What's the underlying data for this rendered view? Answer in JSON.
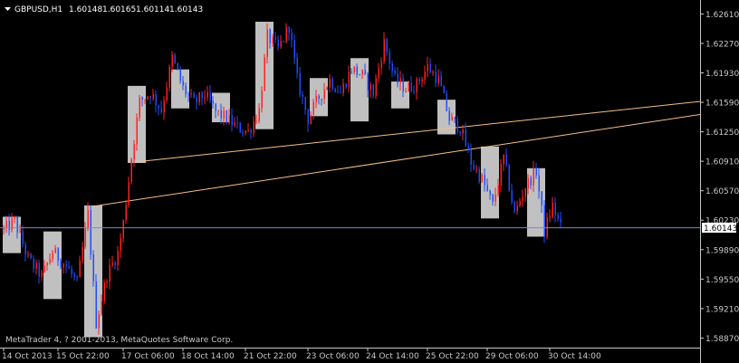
{
  "header": {
    "symbol_timeframe": "GBPUSD,H1",
    "open": "1.60148",
    "high": "1.60165",
    "low": "1.60114",
    "close": "1.60143"
  },
  "footer": {
    "copyright": "MetaTrader 4, ? 2001-2013, MetaQuotes Software Corp."
  },
  "current_price": {
    "label": "1.60143",
    "value": 1.60143
  },
  "colors": {
    "background": "#000000",
    "up_candle": "#ff2020",
    "down_candle": "#1e4dff",
    "box_fill": "#c0c0c0",
    "trendline": "#f5c08a",
    "price_line": "#6f8fbf",
    "axis": "#c8c8c8"
  },
  "chart_data": {
    "type": "candlestick",
    "title": "GBPUSD,H1",
    "ylim": [
      1.5877,
      1.6275
    ],
    "y_ticks": [
      {
        "label": "1.62610",
        "value": 1.6261
      },
      {
        "label": "1.62270",
        "value": 1.6227
      },
      {
        "label": "1.61930",
        "value": 1.6193
      },
      {
        "label": "1.61590",
        "value": 1.6159
      },
      {
        "label": "1.61250",
        "value": 1.6125
      },
      {
        "label": "1.60910",
        "value": 1.6091
      },
      {
        "label": "1.60570",
        "value": 1.6057
      },
      {
        "label": "1.60230",
        "value": 1.6023
      },
      {
        "label": "1.59890",
        "value": 1.5989
      },
      {
        "label": "1.59550",
        "value": 1.5955
      },
      {
        "label": "1.59210",
        "value": 1.5921
      },
      {
        "label": "1.58870",
        "value": 1.5887
      }
    ],
    "x_ticks": [
      {
        "label": "14 Oct 2013",
        "bar": 0
      },
      {
        "label": "15 Oct 22:00",
        "bar": 20
      },
      {
        "label": "17 Oct 06:00",
        "bar": 44
      },
      {
        "label": "18 Oct 14:00",
        "bar": 66
      },
      {
        "label": "21 Oct 22:00",
        "bar": 89
      },
      {
        "label": "23 Oct 06:00",
        "bar": 112
      },
      {
        "label": "24 Oct 14:00",
        "bar": 134
      },
      {
        "label": "25 Oct 22:00",
        "bar": 156
      },
      {
        "label": "29 Oct 06:00",
        "bar": 178
      },
      {
        "label": "30 Oct 14:00",
        "bar": 201
      }
    ],
    "bar_count": 205,
    "anchors": [
      [
        0,
        1.6012
      ],
      [
        4,
        1.6022
      ],
      [
        9,
        1.5978
      ],
      [
        14,
        1.5958
      ],
      [
        18,
        1.5987
      ],
      [
        23,
        1.597
      ],
      [
        27,
        1.595
      ],
      [
        31,
        1.603
      ],
      [
        34,
        1.5905
      ],
      [
        38,
        1.596
      ],
      [
        42,
        1.5985
      ],
      [
        44,
        1.602
      ],
      [
        47,
        1.6095
      ],
      [
        50,
        1.616
      ],
      [
        54,
        1.617
      ],
      [
        58,
        1.615
      ],
      [
        62,
        1.621
      ],
      [
        66,
        1.6175
      ],
      [
        70,
        1.6158
      ],
      [
        74,
        1.6168
      ],
      [
        78,
        1.6148
      ],
      [
        82,
        1.614
      ],
      [
        86,
        1.613
      ],
      [
        90,
        1.6125
      ],
      [
        94,
        1.615
      ],
      [
        97,
        1.6235
      ],
      [
        101,
        1.622
      ],
      [
        105,
        1.6247
      ],
      [
        108,
        1.6185
      ],
      [
        112,
        1.614
      ],
      [
        116,
        1.6165
      ],
      [
        120,
        1.6185
      ],
      [
        124,
        1.617
      ],
      [
        128,
        1.6198
      ],
      [
        132,
        1.619
      ],
      [
        136,
        1.617
      ],
      [
        140,
        1.6228
      ],
      [
        144,
        1.6185
      ],
      [
        148,
        1.6175
      ],
      [
        152,
        1.618
      ],
      [
        156,
        1.62
      ],
      [
        160,
        1.6185
      ],
      [
        164,
        1.614
      ],
      [
        168,
        1.613
      ],
      [
        172,
        1.609
      ],
      [
        176,
        1.607
      ],
      [
        180,
        1.604
      ],
      [
        184,
        1.6095
      ],
      [
        188,
        1.603
      ],
      [
        192,
        1.6062
      ],
      [
        196,
        1.608
      ],
      [
        199,
        1.601
      ],
      [
        202,
        1.604
      ],
      [
        205,
        1.6014
      ]
    ],
    "boxes": [
      {
        "bar_start": 0,
        "bar_end": 6,
        "high": 1.6027,
        "low": 1.5985
      },
      {
        "bar_start": 15,
        "bar_end": 21,
        "high": 1.601,
        "low": 1.5932
      },
      {
        "bar_start": 30,
        "bar_end": 36,
        "high": 1.604,
        "low": 1.5888
      },
      {
        "bar_start": 46,
        "bar_end": 52,
        "high": 1.6178,
        "low": 1.6089
      },
      {
        "bar_start": 62,
        "bar_end": 68,
        "high": 1.6197,
        "low": 1.6152
      },
      {
        "bar_start": 77,
        "bar_end": 83,
        "high": 1.617,
        "low": 1.6136
      },
      {
        "bar_start": 93,
        "bar_end": 99,
        "high": 1.6252,
        "low": 1.6128
      },
      {
        "bar_start": 113,
        "bar_end": 119,
        "high": 1.6187,
        "low": 1.6143
      },
      {
        "bar_start": 128,
        "bar_end": 134,
        "high": 1.621,
        "low": 1.6137
      },
      {
        "bar_start": 143,
        "bar_end": 149,
        "high": 1.6183,
        "low": 1.6152
      },
      {
        "bar_start": 160,
        "bar_end": 166,
        "high": 1.6162,
        "low": 1.6122
      },
      {
        "bar_start": 176,
        "bar_end": 182,
        "high": 1.6108,
        "low": 1.6025
      },
      {
        "bar_start": 193,
        "bar_end": 199,
        "high": 1.6083,
        "low": 1.6004
      }
    ],
    "trendlines": [
      {
        "from": [
          48,
          1.609
        ],
        "to": [
          259,
          1.616
        ]
      },
      {
        "from": [
          33,
          1.6039
        ],
        "to": [
          259,
          1.6145
        ]
      }
    ]
  }
}
